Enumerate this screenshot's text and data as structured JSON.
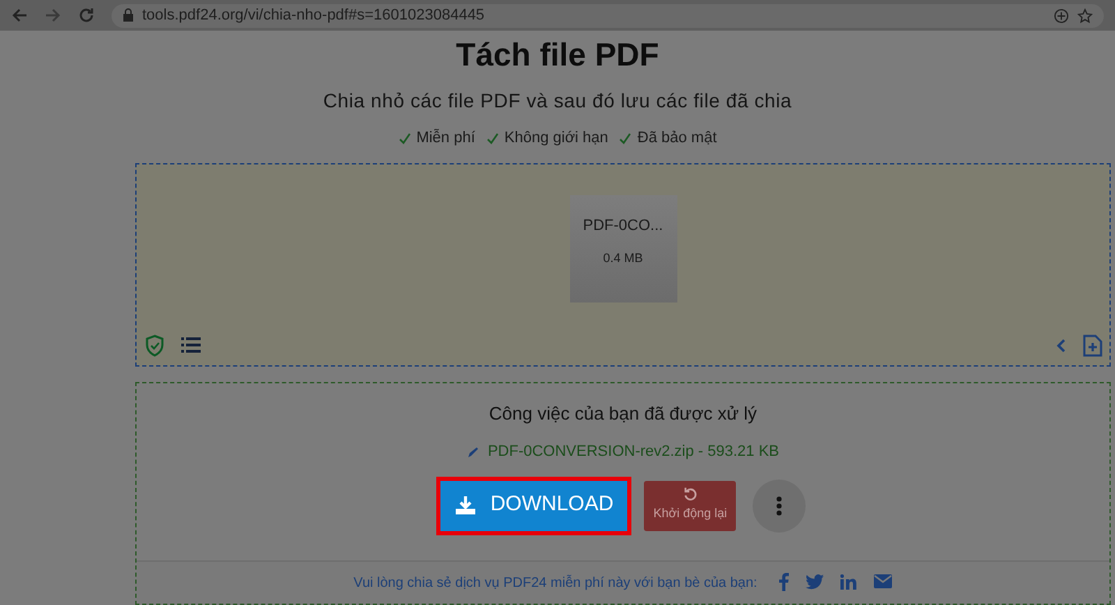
{
  "browser": {
    "url": "tools.pdf24.org/vi/chia-nho-pdf#s=1601023084445"
  },
  "title": "Tách file PDF",
  "subtitle": "Chia nhỏ các file PDF và sau đó lưu các file đã chia",
  "features": [
    "Miễn phí",
    "Không giới hạn",
    "Đã bảo mật"
  ],
  "files": [
    {
      "name": "PDF-0CO...",
      "size": "0.4 MB"
    }
  ],
  "result": {
    "heading": "Công việc của bạn đã được xử lý",
    "file_link": "PDF-0CONVERSION-rev2.zip - 593.21 KB",
    "buttons": [
      {
        "kind": "download",
        "label": "DOWNLOAD",
        "highlighted": true
      },
      {
        "kind": "restart",
        "label": "Khởi động lại",
        "highlighted": false
      },
      {
        "kind": "more",
        "highlighted": false
      }
    ]
  },
  "share": {
    "text": "Vui lòng chia sẻ dịch vụ PDF24 miễn phí này với bạn bè của bạn:",
    "networks": [
      {
        "kind": "facebook"
      },
      {
        "kind": "twitter"
      },
      {
        "kind": "linkedin"
      },
      {
        "kind": "email"
      }
    ]
  }
}
